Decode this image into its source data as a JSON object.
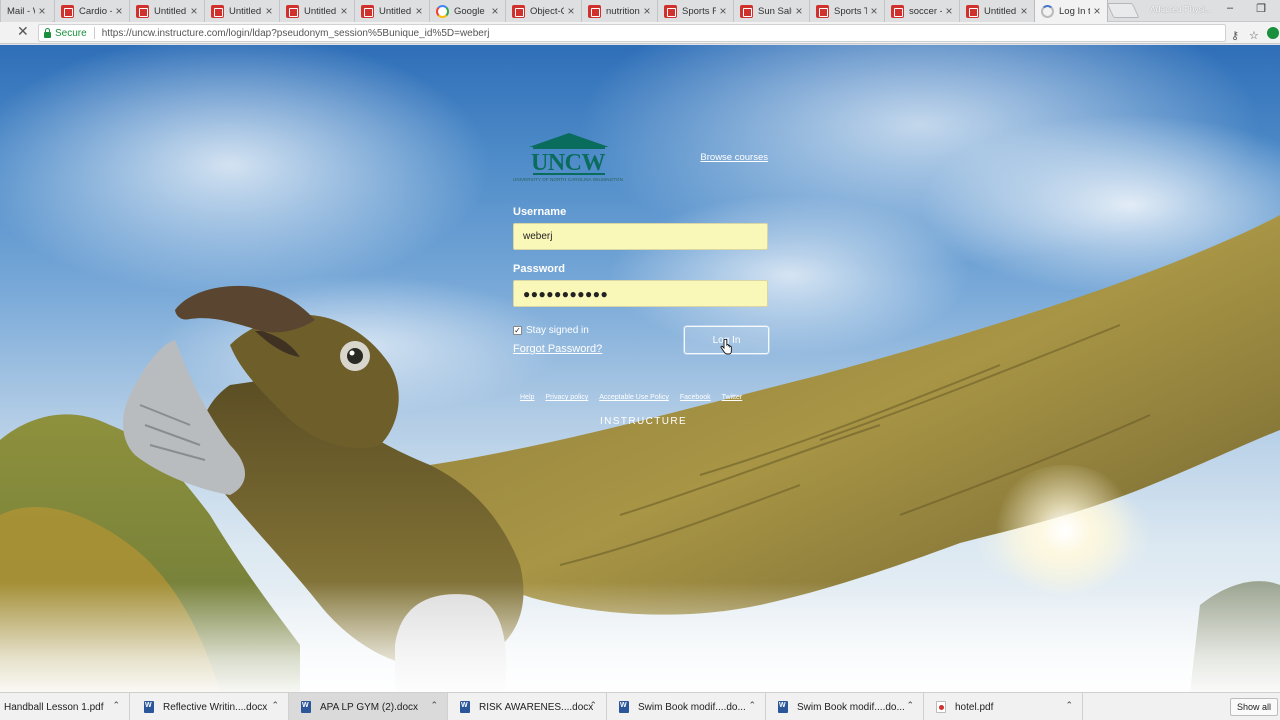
{
  "browser": {
    "tabs": [
      {
        "title": "Mail - We",
        "icon": "none"
      },
      {
        "title": "Cardio - G",
        "icon": "pdf"
      },
      {
        "title": "Untitled d",
        "icon": "pdf"
      },
      {
        "title": "Untitled d",
        "icon": "pdf"
      },
      {
        "title": "Untitled d",
        "icon": "pdf"
      },
      {
        "title": "Untitled d",
        "icon": "pdf"
      },
      {
        "title": "Google",
        "icon": "google"
      },
      {
        "title": "Object-C",
        "icon": "pdf"
      },
      {
        "title": "nutrition",
        "icon": "pdf"
      },
      {
        "title": "Sports Fu",
        "icon": "pdf"
      },
      {
        "title": "Sun Salut",
        "icon": "pdf"
      },
      {
        "title": "Sports Tr",
        "icon": "pdf"
      },
      {
        "title": "soccer -",
        "icon": "pdf"
      },
      {
        "title": "Untitled d",
        "icon": "pdf"
      },
      {
        "title": "Log In to",
        "icon": "loading",
        "active": true
      }
    ],
    "profile_name": "Adapted Physi...",
    "secure_label": "Secure",
    "url": "https://uncw.instructure.com/login/ldap?pseudonym_session%5Bunique_id%5D=weberj"
  },
  "login": {
    "logo_text": "UNCW",
    "logo_subtitle": "UNIVERSITY OF NORTH CAROLINA WILMINGTON",
    "browse_courses": "Browse courses",
    "username_label": "Username",
    "username_value": "weberj",
    "password_label": "Password",
    "password_value": "●●●●●●●●●●●",
    "stay_signed_in": "Stay signed in",
    "stay_signed_in_checked": true,
    "forgot_password": "Forgot Password?",
    "login_button": "Log In",
    "footer_links": [
      "Help",
      "Privacy policy",
      "Acceptable Use Policy",
      "Facebook",
      "Twitter"
    ],
    "vendor": "INSTRUCTURE"
  },
  "downloads": {
    "items": [
      {
        "name": "Handball Lesson 1.pdf",
        "icon": "none"
      },
      {
        "name": "Reflective Writin....docx",
        "icon": "word"
      },
      {
        "name": "APA LP GYM (2).docx",
        "icon": "word",
        "highlight": true
      },
      {
        "name": "RISK AWARENES....docx",
        "icon": "word"
      },
      {
        "name": "Swim Book modif....do...",
        "icon": "word"
      },
      {
        "name": "Swim Book modif....do...",
        "icon": "word"
      },
      {
        "name": "hotel.pdf",
        "icon": "pdf"
      }
    ],
    "show_all": "Show all"
  },
  "colors": {
    "input_autofill": "#faf8b8",
    "uncw_teal": "#0a6c5c",
    "secure_green": "#1a8f3c"
  }
}
